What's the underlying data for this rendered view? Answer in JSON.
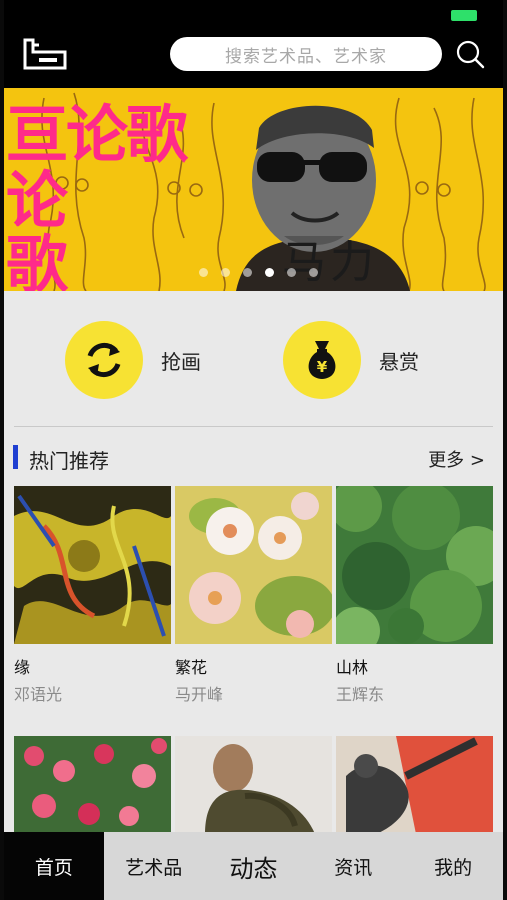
{
  "header": {
    "search_placeholder": "搜索艺术品、艺术家",
    "battery_color": "#2ee06a"
  },
  "icons": {
    "logo": "brand-logo-icon",
    "search": "search-icon",
    "refresh": "refresh-icon",
    "money_bag": "money-bag-icon"
  },
  "banner": {
    "pink_text_top": "亘论歌",
    "pink_text_left": [
      "论",
      "歌"
    ],
    "artist_name": "马力",
    "slide_count": 6,
    "active_slide": 4
  },
  "actions": [
    {
      "label": "抢画",
      "icon": "refresh-icon"
    },
    {
      "label": "悬赏",
      "icon": "money-bag-icon"
    }
  ],
  "section": {
    "title": "热门推荐",
    "more": "更多 >",
    "accent": "#1f3fd1"
  },
  "artworks": [
    {
      "title": "缘",
      "artist": "邓语光"
    },
    {
      "title": "繁花",
      "artist": "马开峰"
    },
    {
      "title": "山林",
      "artist": "王辉东"
    }
  ],
  "nav": [
    {
      "label": "首页",
      "active": true
    },
    {
      "label": "艺术品"
    },
    {
      "label": "动态"
    },
    {
      "label": "资讯"
    },
    {
      "label": "我的"
    }
  ],
  "colors": {
    "action_circle": "#f7e233",
    "banner_bg": "#f4c40f",
    "banner_pink": "#ff2a8a"
  }
}
